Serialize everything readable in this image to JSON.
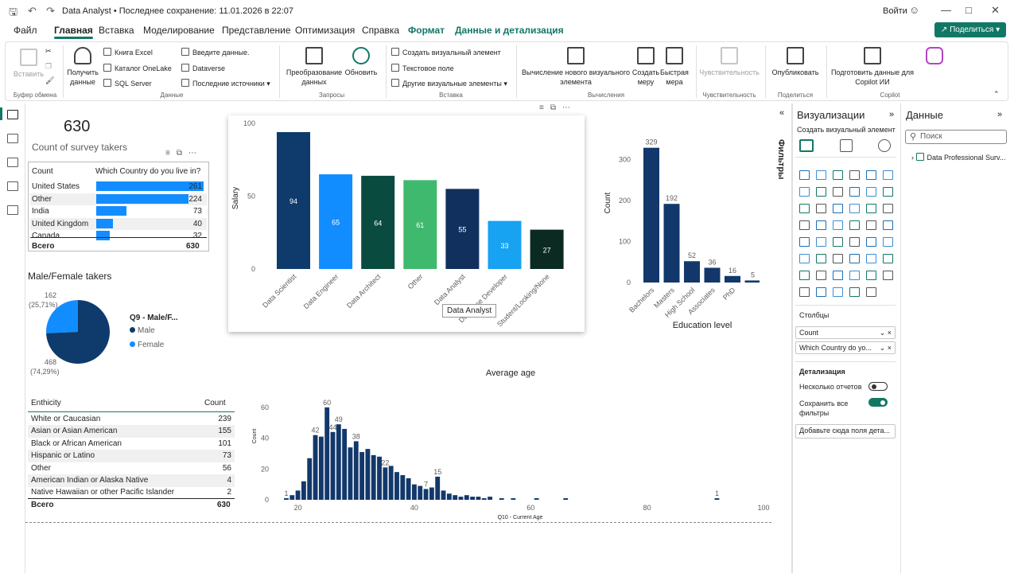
{
  "titlebar": {
    "title": "Data Analyst • Последнее сохранение: 11.01.2026 в 22:07",
    "signin": "Войти"
  },
  "menu": {
    "tabs": [
      "Файл",
      "Главная",
      "Вставка",
      "Моделирование",
      "Представление",
      "Оптимизация",
      "Справка",
      "Формат",
      "Данные и детализация"
    ],
    "share": "Поделиться"
  },
  "ribbon": {
    "paste": "Вставить",
    "clipboard": "Буфер обмена",
    "get_data": "Получить данные",
    "excel": "Книга Excel",
    "onelake": "Каталог OneLake",
    "sql": "SQL Server",
    "enter_data": "Введите данные.",
    "dataverse": "Dataverse",
    "recent": "Последние источники",
    "data_group": "Данные",
    "transform": "Преобразование данных",
    "refresh": "Обновить",
    "queries": "Запросы",
    "new_visual": "Создать визуальный элемент",
    "text_box": "Текстовое поле",
    "more_visuals": "Другие визуальные элементы",
    "insert": "Вставка",
    "new_calc": "Вычисление нового визуального элемента",
    "new_measure": "Создать меру",
    "quick_measure": "Быстрая мера",
    "calculations": "Вычисления",
    "sensitivity": "Чувствительность",
    "publish": "Опубликовать",
    "share_group": "Поделиться",
    "copilot_prep": "Подготовить данные для Copilot ИИ",
    "copilot": "Copilot"
  },
  "kpi": {
    "value": "630",
    "label": "Count of survey takers"
  },
  "country_table": {
    "col1": "Count",
    "col2": "Which Country do you live in?",
    "rows": [
      {
        "name": "United States",
        "value": 261
      },
      {
        "name": "Other",
        "value": 224
      },
      {
        "name": "India",
        "value": 73
      },
      {
        "name": "United Kingdom",
        "value": 40
      },
      {
        "name": "Canada",
        "value": 32
      }
    ],
    "total_label": "Всего",
    "total_value": "630"
  },
  "pie": {
    "title": "Male/Female takers",
    "legend_title": "Q9 - Male/F...",
    "legend": [
      "Male",
      "Female"
    ],
    "label_female": "162",
    "label_female_pct": "(25,71%)",
    "label_male": "468",
    "label_male_pct": "(74,29%)",
    "colors": {
      "male": "#12239e",
      "female": "#118dff"
    }
  },
  "ethnicity": {
    "col1": "Enthicity",
    "col2": "Count",
    "rows": [
      {
        "name": "White or Caucasian",
        "value": "239"
      },
      {
        "name": "Asian or Asian American",
        "value": "155"
      },
      {
        "name": "Black or African American",
        "value": "101"
      },
      {
        "name": "Hispanic or Latino",
        "value": "73"
      },
      {
        "name": "Other",
        "value": "56"
      },
      {
        "name": "American Indian or Alaska Native",
        "value": "4"
      },
      {
        "name": "Native Hawaiian or other Pacific Islander",
        "value": "2"
      }
    ],
    "total_label": "Всего",
    "total_value": "630"
  },
  "tooltip": "Data Analyst",
  "viz_pane": {
    "title": "Визуализации",
    "subtitle": "Создать визуальный элемент",
    "filters": "Фильтры",
    "columns_label": "Столбцы",
    "well1": "Count",
    "well2": "Which Country do yo...",
    "drill_label": "Детализация",
    "multi_report": "Несколько отчетов",
    "keep_filters": "Сохранить все фильтры",
    "add_drill": "Добавьте сюда поля дета..."
  },
  "data_pane": {
    "title": "Данные",
    "search": "Поиск",
    "item": "Data Professional Surv..."
  },
  "chart_data": [
    {
      "type": "bar",
      "categories": [
        "Data Scientist",
        "Data Engineer",
        "Data Architect",
        "Other",
        "Data Analyst",
        "Database Developer",
        "Student/Looking/None"
      ],
      "values": [
        94,
        65,
        64,
        61,
        55,
        33,
        27
      ],
      "colors": [
        "#0e3b6c",
        "#118dff",
        "#0a4b3f",
        "#3fb96e",
        "#12305e",
        "#17a2f2",
        "#0b2a22"
      ],
      "ylabel": "Salary",
      "ylim": [
        0,
        100
      ],
      "yticks": [
        0,
        50,
        100
      ]
    },
    {
      "type": "bar",
      "categories": [
        "Bachelors",
        "Masters",
        "High School",
        "Associates",
        "PhD"
      ],
      "values": [
        329,
        192,
        52,
        36,
        16,
        5
      ],
      "xlabel": "Education level",
      "ylabel": "Count",
      "ylim": [
        0,
        340
      ],
      "yticks": [
        0,
        100,
        200,
        300
      ],
      "color": "#12386b"
    },
    {
      "type": "bar",
      "title": "Average age",
      "xlabel": "Q10 - Current Age",
      "ylabel": "Count",
      "xlim": [
        15,
        100
      ],
      "ylim": [
        0,
        62
      ],
      "xticks": [
        20,
        40,
        60,
        80,
        100
      ],
      "yticks": [
        0,
        20,
        40,
        60
      ],
      "x": [
        18,
        19,
        20,
        21,
        22,
        23,
        24,
        25,
        26,
        27,
        28,
        29,
        30,
        31,
        32,
        33,
        34,
        35,
        36,
        37,
        38,
        39,
        40,
        41,
        42,
        43,
        44,
        45,
        46,
        47,
        48,
        49,
        50,
        51,
        52,
        53,
        55,
        57,
        61,
        66,
        92
      ],
      "values": [
        1,
        3,
        6,
        12,
        27,
        42,
        41,
        60,
        44,
        49,
        46,
        34,
        38,
        31,
        33,
        29,
        28,
        21,
        22,
        18,
        16,
        14,
        10,
        9,
        7,
        8,
        15,
        6,
        4,
        3,
        2,
        3,
        2,
        2,
        1,
        2,
        1,
        1,
        1,
        1,
        1
      ],
      "data_labels": [
        {
          "x": 18,
          "label": "1"
        },
        {
          "x": 23,
          "label": "42"
        },
        {
          "x": 25,
          "label": "60"
        },
        {
          "x": 27,
          "label": "49"
        },
        {
          "x": 26,
          "label": "44"
        },
        {
          "x": 30,
          "label": "38"
        },
        {
          "x": 35,
          "label": "22"
        },
        {
          "x": 42,
          "label": "7"
        },
        {
          "x": 44,
          "label": "15"
        },
        {
          "x": 92,
          "label": "1"
        }
      ],
      "color": "#12386b"
    }
  ]
}
